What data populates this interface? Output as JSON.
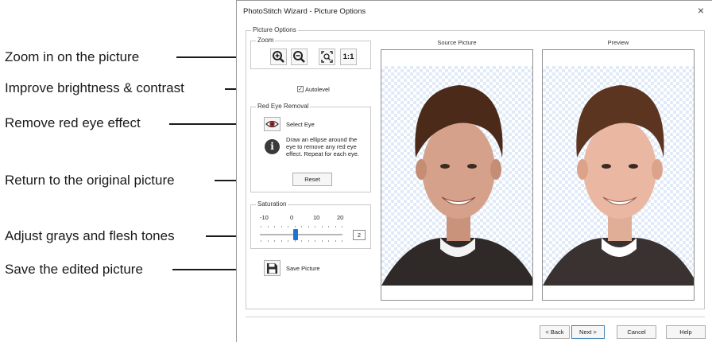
{
  "callouts": {
    "zoom": "Zoom in on the picture",
    "brightness": "Improve brightness & contrast",
    "red_eye": "Remove red eye effect",
    "reset": "Return to the original picture",
    "saturation": "Adjust grays and flesh tones",
    "save": "Save the edited picture"
  },
  "dialog": {
    "title": "PhotoStitch Wizard - Picture Options",
    "close_glyph": "×",
    "picture_options_label": "Picture Options",
    "zoom": {
      "label": "Zoom",
      "one_to_one_label": "1:1"
    },
    "autolevel": {
      "label": "Autolevel",
      "checked": true,
      "check_glyph": "✓"
    },
    "red_eye": {
      "label": "Red Eye Removal",
      "select_eye_label": "Select Eye",
      "info_glyph": "i",
      "info_text_1": "Draw an ellipse around the",
      "info_text_2": "eye to remove any red eye",
      "info_text_3": "effect. Repeat for each eye.",
      "reset_label": "Reset"
    },
    "saturation": {
      "label": "Saturation",
      "ticks": [
        "-10",
        "0",
        "10",
        "20"
      ],
      "value": "2"
    },
    "save_picture_label": "Save Picture",
    "source_picture_label": "Source Picture",
    "preview_label": "Preview",
    "footer": {
      "back_label": "< Back",
      "next_label": "Next >",
      "cancel_label": "Cancel",
      "help_label": "Help"
    }
  },
  "colors": {
    "accent": "#1e73d6",
    "checker": "#e1ebf8",
    "text": "#1a1a1a"
  }
}
